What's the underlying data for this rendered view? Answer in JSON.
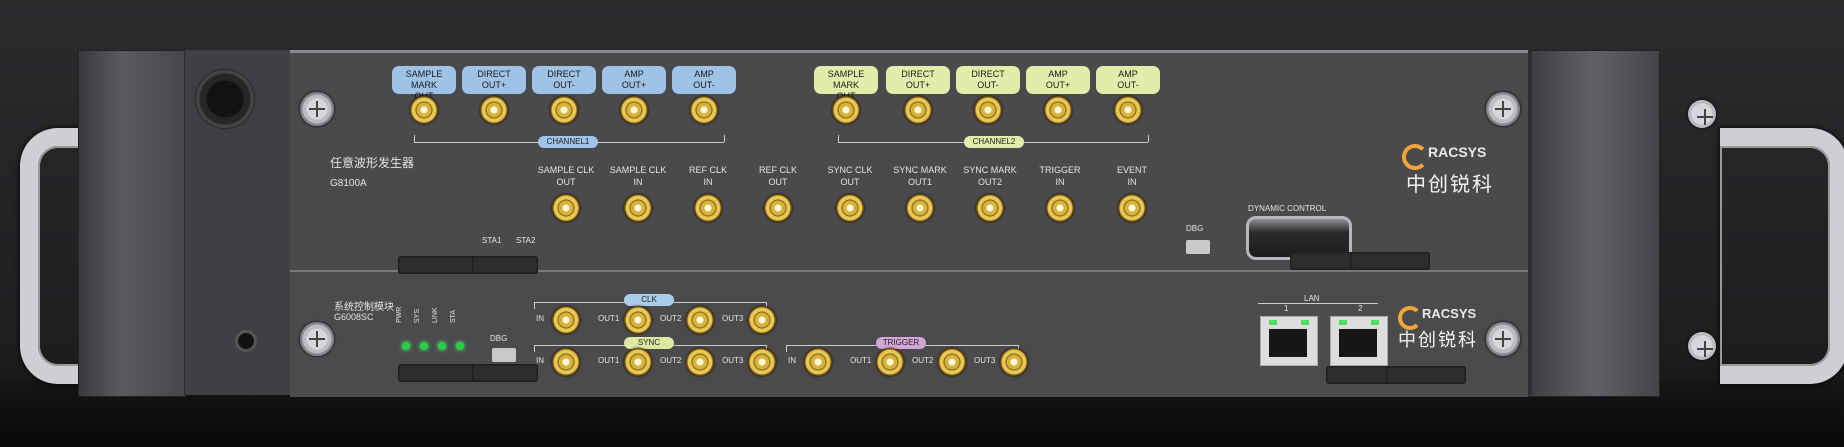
{
  "device": {
    "top_module": {
      "name_cn": "任意波形发生器",
      "model": "G8100A",
      "channel1_label": "CHANNEL1",
      "channel2_label": "CHANNEL2",
      "channel1_ports": [
        "SAMPLE MARK\nOUT",
        "DIRECT\nOUT+",
        "DIRECT\nOUT-",
        "AMP\nOUT+",
        "AMP\nOUT-"
      ],
      "channel2_ports": [
        "SAMPLE MARK\nOUT",
        "DIRECT\nOUT+",
        "DIRECT\nOUT-",
        "AMP\nOUT+",
        "AMP\nOUT-"
      ],
      "middle_ports": [
        "SAMPLE CLK\nOUT",
        "SAMPLE CLK\nIN",
        "REF CLK\nIN",
        "REF CLK\nOUT",
        "SYNC CLK\nOUT",
        "SYNC MARK\nOUT1",
        "SYNC MARK\nOUT2",
        "TRIGGER\nIN",
        "EVENT\nIN"
      ],
      "sta1": "STA1",
      "sta2": "STA2",
      "dbg": "DBG",
      "dynamic_control": "DYNAMIC CONTROL"
    },
    "bottom_module": {
      "name_cn": "系统控制模块",
      "model": "G6008SC",
      "leds": [
        "PWR",
        "SYS",
        "LINK",
        "STA"
      ],
      "dbg": "DBG",
      "clk_label": "CLK",
      "sync_label": "SYNC",
      "trigger_label": "TRIGGER",
      "clk_ports": [
        "IN",
        "OUT1",
        "OUT2",
        "OUT3"
      ],
      "sync_ports": [
        "IN",
        "OUT1",
        "OUT2",
        "OUT3"
      ],
      "trigger_ports": [
        "IN",
        "OUT1",
        "OUT2",
        "OUT3"
      ],
      "lan_label": "LAN",
      "lan_ports": [
        "1",
        "2"
      ]
    },
    "brand": {
      "name": "RACSYS",
      "name_cn": "中创锐科"
    },
    "colors": {
      "blue_label": "#9ec3e6",
      "yellow_label": "#e4ecab",
      "clk_pill": "#a9cce9",
      "sync_pill": "#dde8a1",
      "trigger_pill": "#d2a6d6",
      "led": "#26d046",
      "logo_orange": "#f3a53b"
    }
  }
}
